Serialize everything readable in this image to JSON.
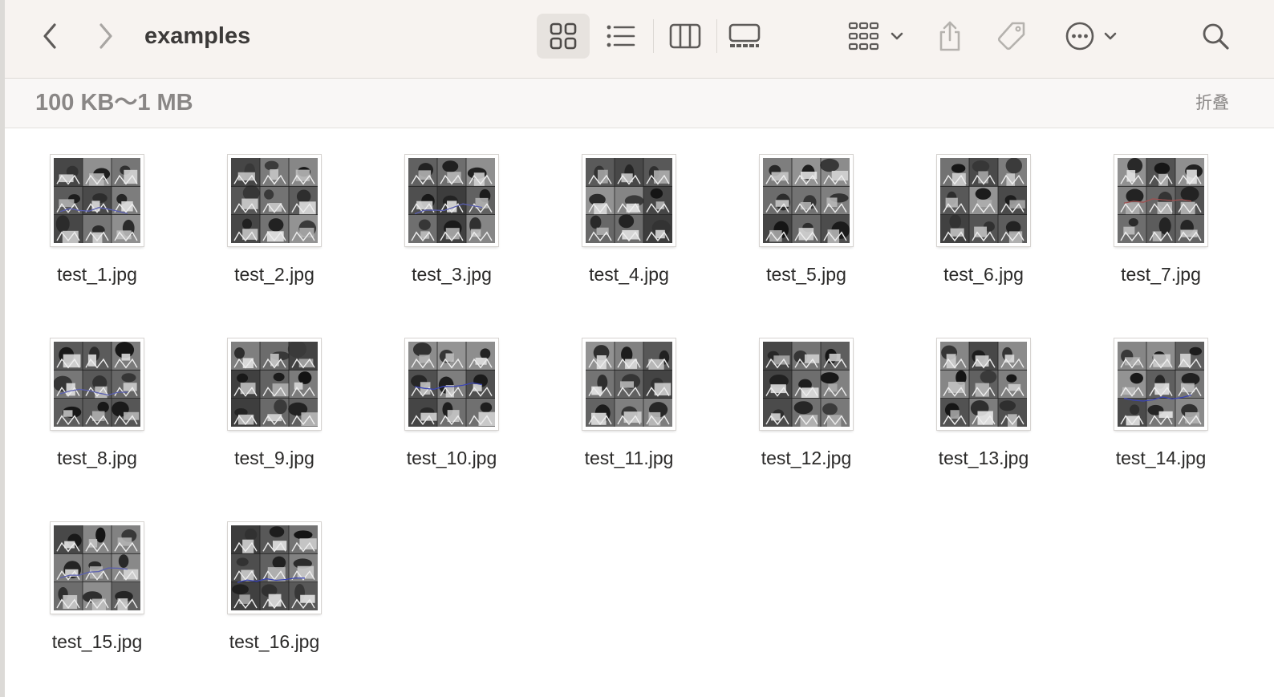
{
  "window": {
    "title": "examples"
  },
  "toolbar": {
    "back_icon": "chevron-left-icon",
    "forward_icon": "chevron-right-icon",
    "views": [
      "icon-view",
      "list-view",
      "column-view",
      "gallery-view"
    ],
    "active_view": "icon-view",
    "group_icon": "group-by-icon",
    "share_icon": "share-icon",
    "tag_icon": "tag-icon",
    "more_icon": "ellipsis-circle-icon",
    "search_icon": "search-icon"
  },
  "group": {
    "title": "100 KB～1 MB",
    "collapse_label": "折叠"
  },
  "files": [
    {
      "name": "test_1.jpg",
      "line": "#5a5fb0"
    },
    {
      "name": "test_2.jpg",
      "line": ""
    },
    {
      "name": "test_3.jpg",
      "line": "#5a5fb0"
    },
    {
      "name": "test_4.jpg",
      "line": ""
    },
    {
      "name": "test_5.jpg",
      "line": ""
    },
    {
      "name": "test_6.jpg",
      "line": ""
    },
    {
      "name": "test_7.jpg",
      "line": "#a05050"
    },
    {
      "name": "test_8.jpg",
      "line": "#5a5fb0"
    },
    {
      "name": "test_9.jpg",
      "line": ""
    },
    {
      "name": "test_10.jpg",
      "line": "#3b45b5"
    },
    {
      "name": "test_11.jpg",
      "line": ""
    },
    {
      "name": "test_12.jpg",
      "line": ""
    },
    {
      "name": "test_13.jpg",
      "line": ""
    },
    {
      "name": "test_14.jpg",
      "line": "#3b45b5"
    },
    {
      "name": "test_15.jpg",
      "line": "#5a5fb0"
    },
    {
      "name": "test_16.jpg",
      "line": "#3b45b5"
    }
  ]
}
